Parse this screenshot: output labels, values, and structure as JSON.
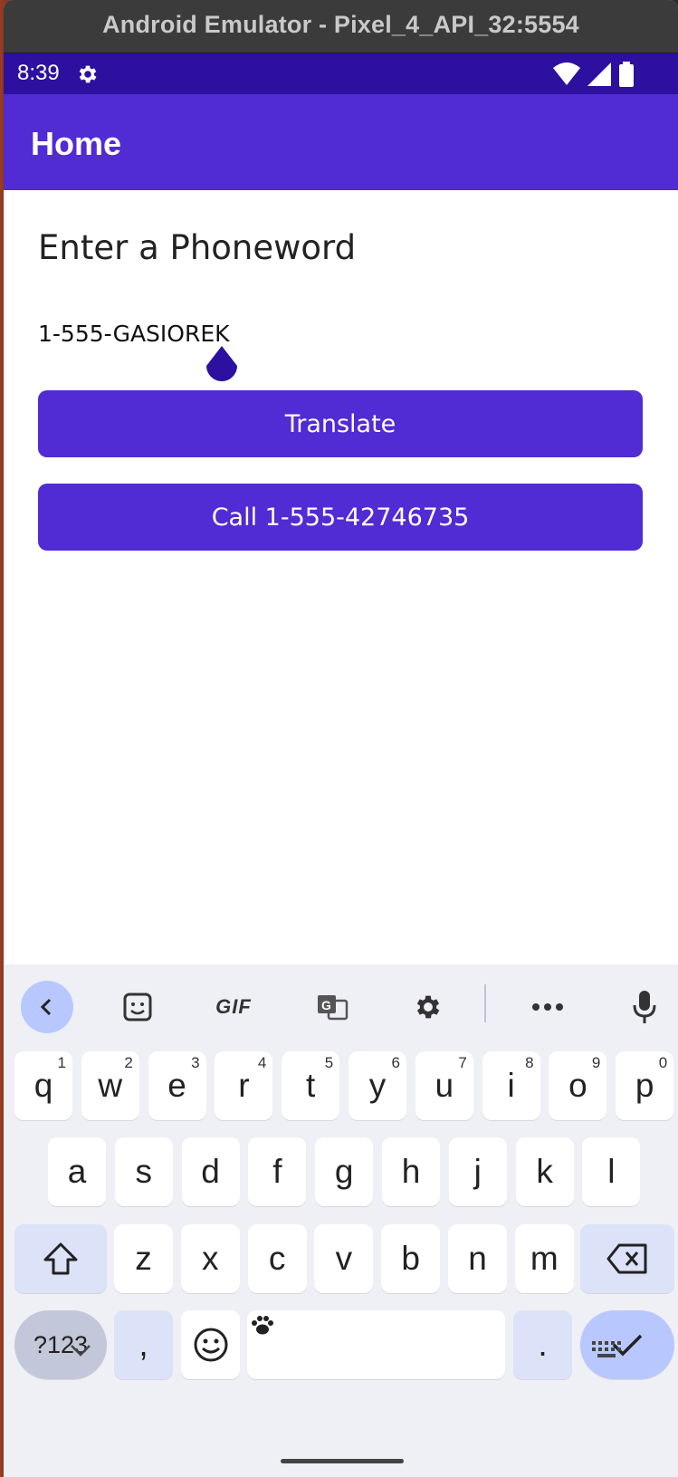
{
  "window": {
    "title": "Android Emulator - Pixel_4_API_32:5554"
  },
  "status_bar": {
    "time": "8:39",
    "icons": [
      "gear-icon",
      "wifi-icon",
      "signal-icon",
      "battery-icon"
    ]
  },
  "app_bar": {
    "title": "Home"
  },
  "main": {
    "label": "Enter a Phoneword",
    "entry_value": "1-555-GASIOREK",
    "translate_label": "Translate",
    "call_label": "Call 1-555-42746735"
  },
  "colors": {
    "primary": "#512bd4",
    "status_bar": "#2d10a0",
    "keyboard_bg": "#eff0f5"
  },
  "keyboard": {
    "toolbar": [
      "back-icon",
      "sticker-icon",
      "GIF",
      "translate-icon",
      "settings-icon",
      "more-icon",
      "mic-icon"
    ],
    "gif_label": "GIF",
    "row1": [
      {
        "k": "q",
        "h": "1"
      },
      {
        "k": "w",
        "h": "2"
      },
      {
        "k": "e",
        "h": "3"
      },
      {
        "k": "r",
        "h": "4"
      },
      {
        "k": "t",
        "h": "5"
      },
      {
        "k": "y",
        "h": "6"
      },
      {
        "k": "u",
        "h": "7"
      },
      {
        "k": "i",
        "h": "8"
      },
      {
        "k": "o",
        "h": "9"
      },
      {
        "k": "p",
        "h": "0"
      }
    ],
    "row2": [
      "a",
      "s",
      "d",
      "f",
      "g",
      "h",
      "j",
      "k",
      "l"
    ],
    "row3": [
      "z",
      "x",
      "c",
      "v",
      "b",
      "n",
      "m"
    ],
    "symbols_label": "?123",
    "comma_label": ",",
    "period_label": "."
  }
}
